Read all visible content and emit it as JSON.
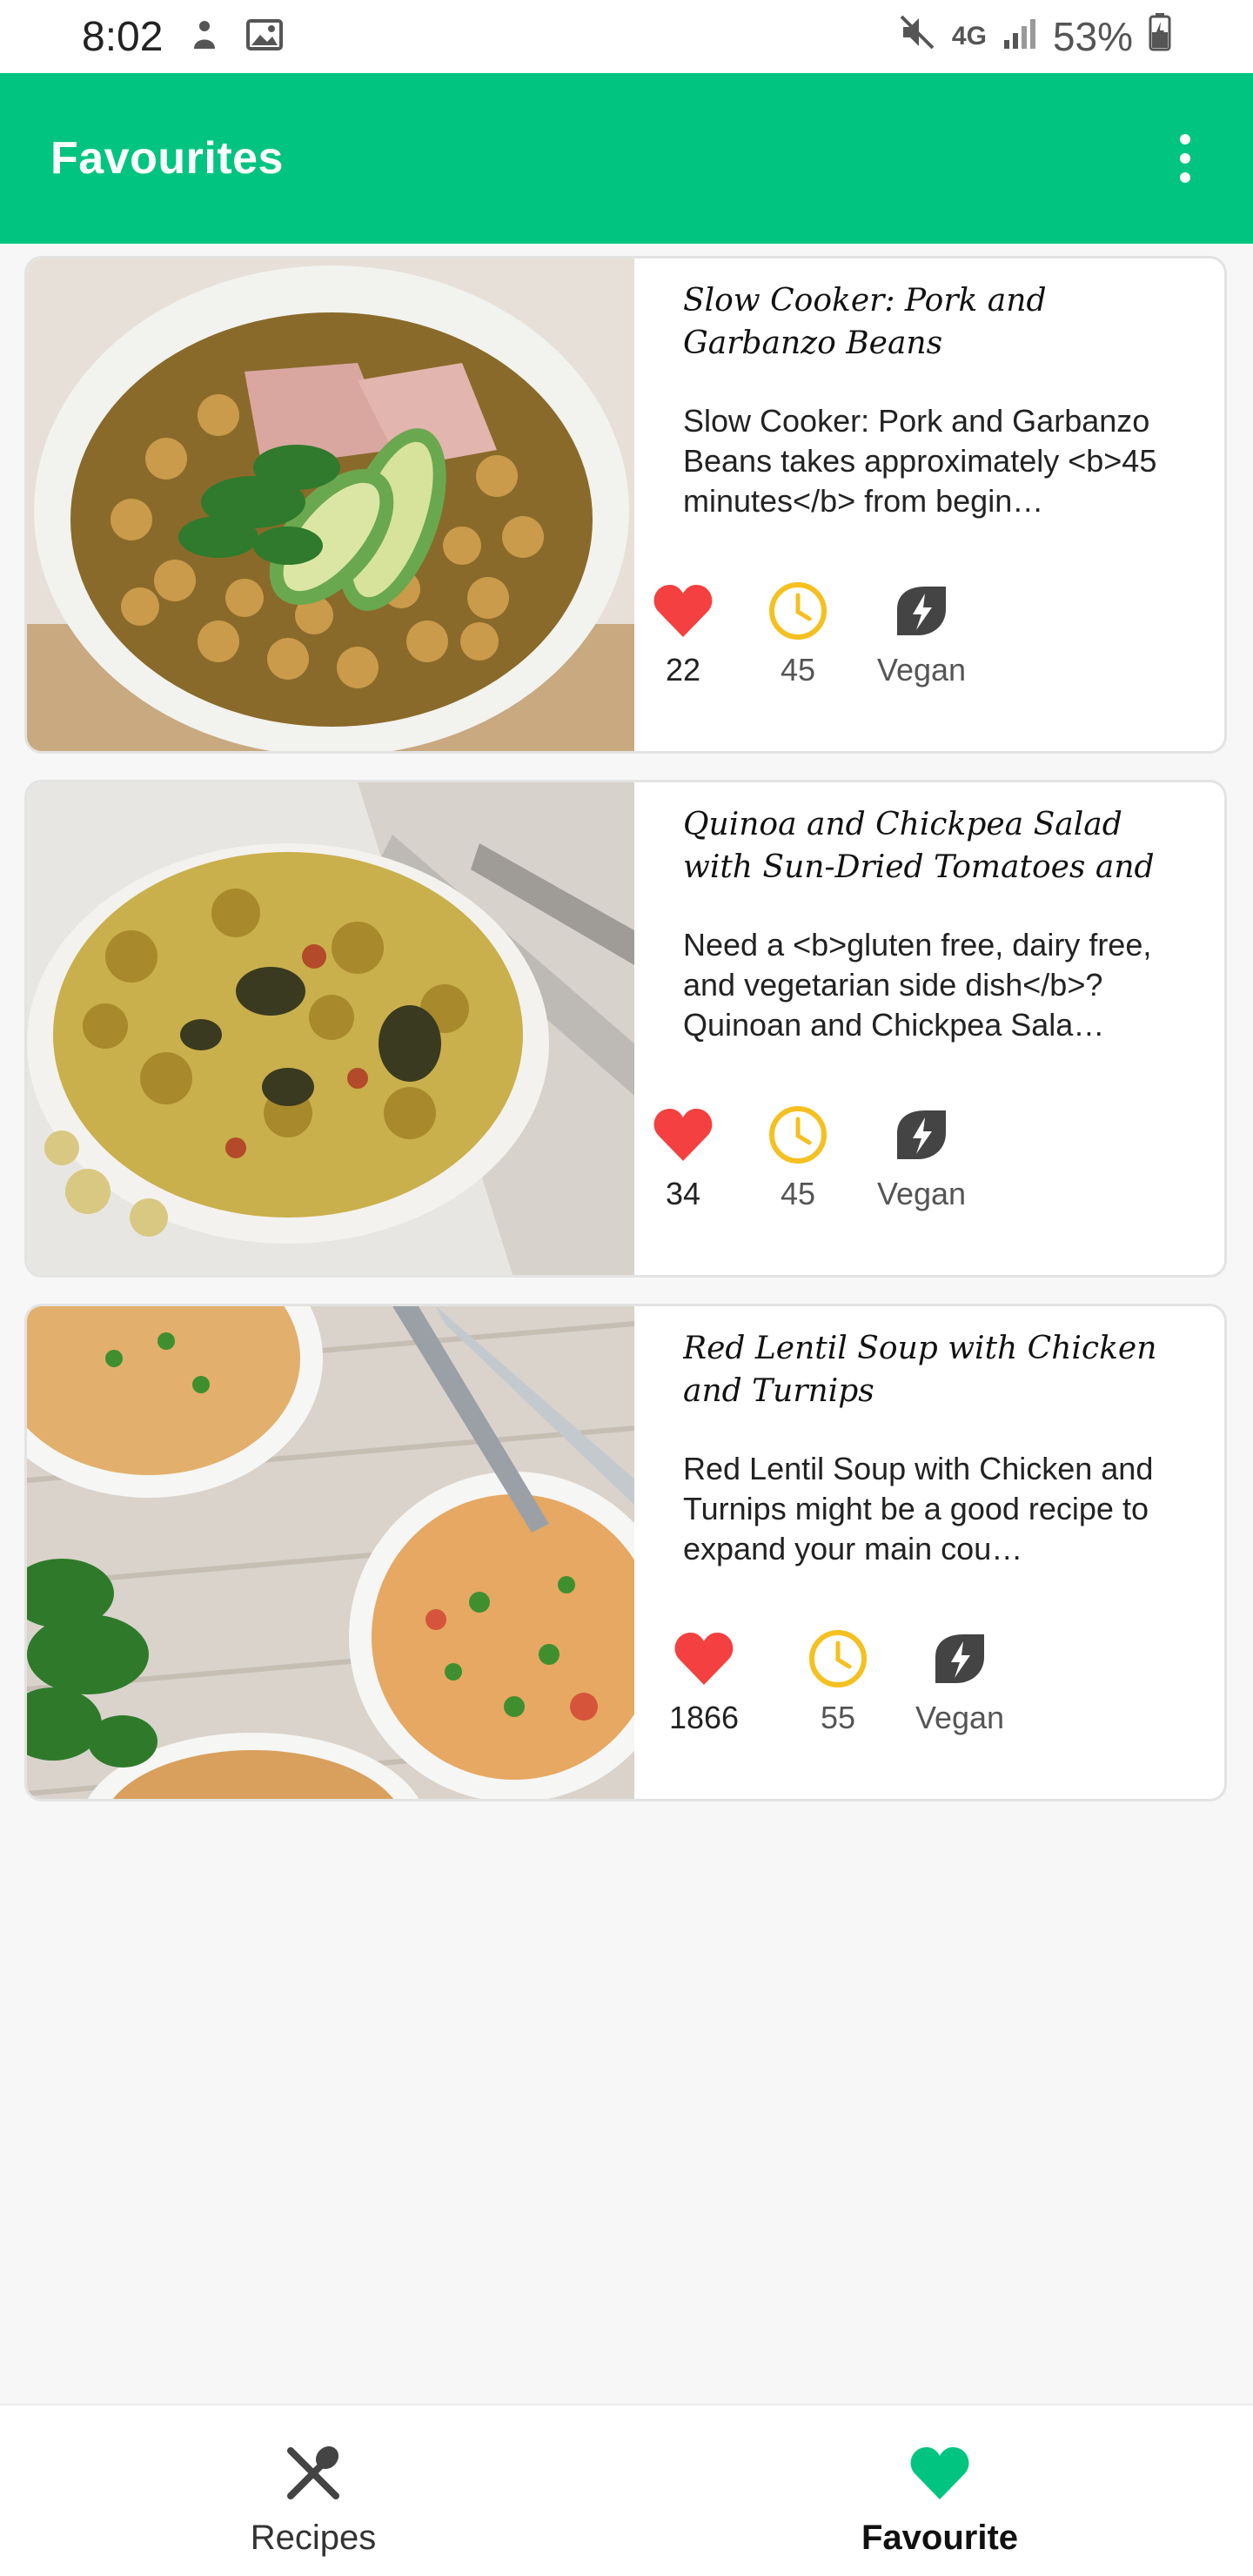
{
  "status_bar": {
    "time": "8:02",
    "network": "4G",
    "battery": "53%"
  },
  "app_bar": {
    "title": "Favourites"
  },
  "recipes": [
    {
      "title": "Slow Cooker: Pork and Garbanzo Beans",
      "description": "Slow Cooker: Pork and Garbanzo Beans takes approximately <b>45 minutes</b> from begin…",
      "likes": "22",
      "minutes": "45",
      "diet": "Vegan"
    },
    {
      "title": "Quinoa and Chickpea Salad with Sun-Dried Tomatoes and Dried …",
      "description": "Need a <b>gluten free, dairy free, and vegetarian side dish</b>? Quinoan and Chickpea Sala…",
      "likes": "34",
      "minutes": "45",
      "diet": "Vegan"
    },
    {
      "title": "Red Lentil Soup with Chicken and Turnips",
      "description": "Red Lentil Soup with Chicken and Turnips might be a good recipe to expand your main cou…",
      "likes": "1866",
      "minutes": "55",
      "diet": "Vegan"
    }
  ],
  "bottom_nav": {
    "recipes_label": "Recipes",
    "favourite_label": "Favourite"
  },
  "colors": {
    "primary": "#00c480",
    "heart": "#f44040",
    "clock": "#f5c020",
    "leaf": "#444444"
  },
  "icons": {
    "heart": "heart-icon",
    "clock": "clock-icon",
    "leaf": "leaf-icon",
    "menu": "more-vert-icon",
    "recipes": "fork-knife-icon",
    "favourite": "heart-icon"
  }
}
